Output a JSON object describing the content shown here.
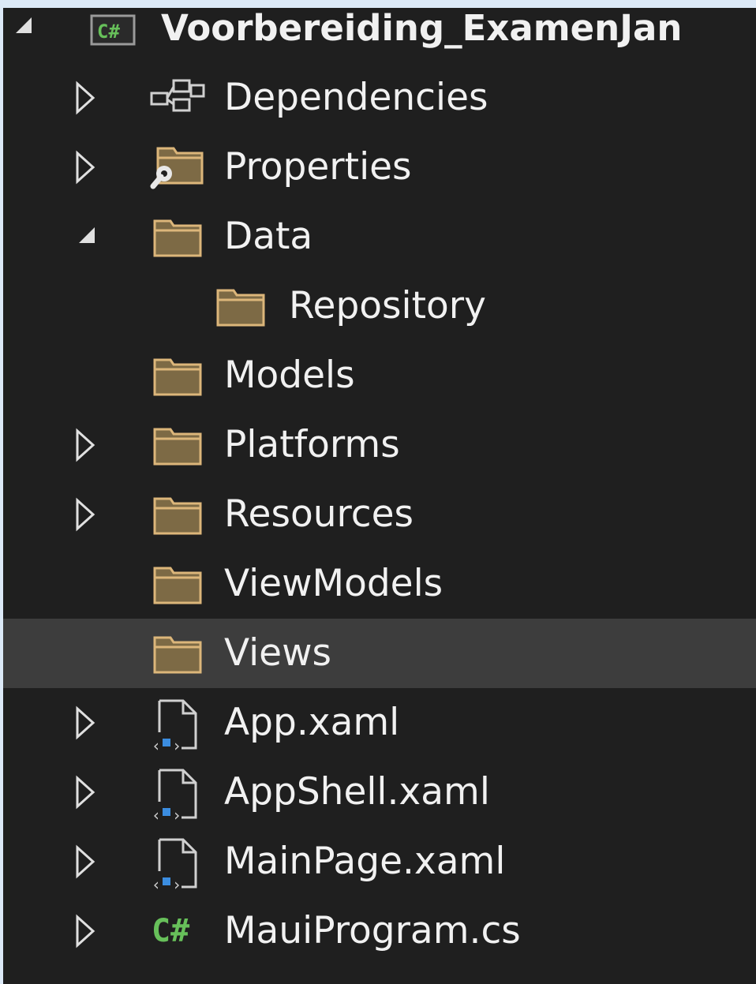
{
  "project": {
    "name": "Voorbereiding_ExamenJan",
    "icon": "csharp-project-icon"
  },
  "items": [
    {
      "label": "Dependencies",
      "icon": "dependencies-icon",
      "expander": "collapsed"
    },
    {
      "label": "Properties",
      "icon": "properties-folder-icon",
      "expander": "collapsed"
    },
    {
      "label": "Data",
      "icon": "folder-icon",
      "expander": "expanded"
    },
    {
      "label": "Repository",
      "icon": "folder-icon",
      "expander": "none"
    },
    {
      "label": "Models",
      "icon": "folder-icon",
      "expander": "none"
    },
    {
      "label": "Platforms",
      "icon": "folder-icon",
      "expander": "collapsed"
    },
    {
      "label": "Resources",
      "icon": "folder-icon",
      "expander": "collapsed"
    },
    {
      "label": "ViewModels",
      "icon": "folder-icon",
      "expander": "none"
    },
    {
      "label": "Views",
      "icon": "folder-icon",
      "expander": "none",
      "selected": true
    },
    {
      "label": "App.xaml",
      "icon": "xaml-file-icon",
      "expander": "collapsed"
    },
    {
      "label": "AppShell.xaml",
      "icon": "xaml-file-icon",
      "expander": "collapsed"
    },
    {
      "label": "MainPage.xaml",
      "icon": "xaml-file-icon",
      "expander": "collapsed"
    },
    {
      "label": "MauiProgram.cs",
      "icon": "csharp-file-icon",
      "expander": "collapsed"
    }
  ],
  "colors": {
    "background": "#1f1f1f",
    "selected_row": "#3d3d3d",
    "text": "#f1f1f1",
    "folder": "#dcb67a",
    "csharp": "#67c05a"
  }
}
